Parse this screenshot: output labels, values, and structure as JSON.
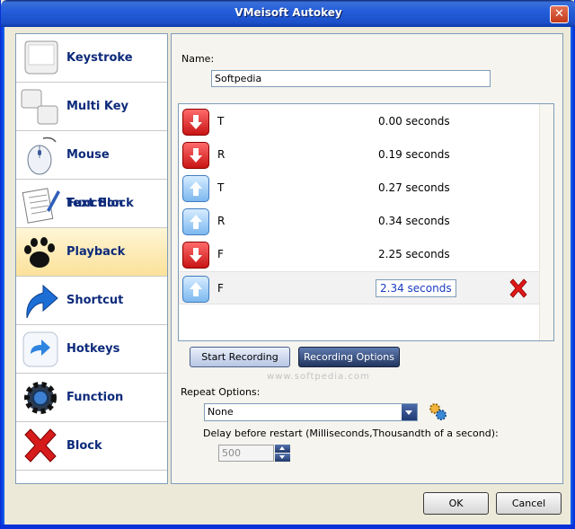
{
  "window": {
    "title": "VMeisoft Autokey",
    "close_glyph": "✕"
  },
  "sidebar": {
    "items": [
      {
        "label": "Keystroke",
        "icon": "keystroke-icon"
      },
      {
        "label": "Multi Key",
        "icon": "multi-key-icon"
      },
      {
        "label": "Mouse Function",
        "icon": "mouse-icon"
      },
      {
        "label": "Text Block",
        "icon": "text-block-icon"
      },
      {
        "label": "Playback",
        "icon": "paw-icon",
        "active": true
      },
      {
        "label": "Shortcut",
        "icon": "shortcut-arrow-icon"
      },
      {
        "label": "Hotkeys",
        "icon": "hotkeys-arrow-icon"
      },
      {
        "label": "Function",
        "icon": "gear-icon"
      },
      {
        "label": "Block",
        "icon": "block-x-icon"
      }
    ]
  },
  "main": {
    "name_label": "Name:",
    "name_value": "Softpedia",
    "events": [
      {
        "direction": "down",
        "key": "T",
        "time": "0.00 seconds"
      },
      {
        "direction": "down",
        "key": "R",
        "time": "0.19 seconds"
      },
      {
        "direction": "up",
        "key": "T",
        "time": "0.27 seconds"
      },
      {
        "direction": "up",
        "key": "R",
        "time": "0.34 seconds"
      },
      {
        "direction": "down",
        "key": "F",
        "time": "2.25 seconds"
      },
      {
        "direction": "up",
        "key": "F",
        "time": "2.34 seconds",
        "selected": true
      }
    ],
    "start_recording": "Start Recording",
    "recording_options": "Recording Options",
    "watermark": "www.softpedia.com",
    "repeat_label": "Repeat Options:",
    "repeat_value": "None",
    "delay_label": "Delay before restart (Milliseconds,Thousandth of a second):",
    "delay_value": "500"
  },
  "footer": {
    "ok": "OK",
    "cancel": "Cancel"
  },
  "colors": {
    "accent": "#0d2a7a",
    "titlebar": "#245edb",
    "down_arrow": "#c81414",
    "up_arrow": "#7cb8ef"
  }
}
